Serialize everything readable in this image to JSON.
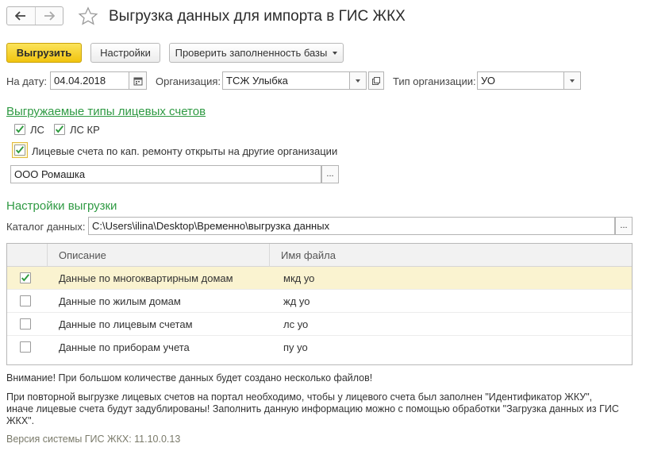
{
  "window": {
    "title": "Выгрузка данных для импорта в ГИС ЖКХ"
  },
  "toolbar": {
    "export_label": "Выгрузить",
    "settings_label": "Настройки",
    "check_label": "Проверить заполненность базы"
  },
  "filters": {
    "date_label": "На дату:",
    "date_value": "04.04.2018",
    "org_label": "Организация:",
    "org_value": "ТСЖ Улыбка",
    "org_type_label": "Тип организации:",
    "org_type_value": "УО"
  },
  "account_types": {
    "heading": "Выгружаемые типы лицевых счетов",
    "ls_label": "ЛС",
    "ls_checked": true,
    "ls_kr_label": "ЛС КР",
    "ls_kr_checked": true,
    "other_org_label": "Лицевые счета по кап. ремонту открыты на другие организации",
    "other_org_checked": true,
    "other_org_value": "ООО Ромашка"
  },
  "export_settings": {
    "heading": "Настройки выгрузки",
    "catalog_label": "Каталог данных:",
    "catalog_value": "C:\\Users\\ilina\\Desktop\\Временно\\выгрузка данных"
  },
  "table": {
    "col_description": "Описание",
    "col_filename": "Имя файла",
    "rows": [
      {
        "checked": true,
        "description": "Данные по многоквартирным домам",
        "filename": "мкд уо"
      },
      {
        "checked": false,
        "description": "Данные по жилым домам",
        "filename": "жд уо"
      },
      {
        "checked": false,
        "description": "Данные по лицевым счетам",
        "filename": "лс уо"
      },
      {
        "checked": false,
        "description": "Данные по приборам учета",
        "filename": "пу уо"
      }
    ]
  },
  "notes": {
    "warning": "Внимание! При большом количестве данных будет создано несколько файлов!",
    "info": "При повторной выгрузке лицевых счетов на портал необходимо, чтобы у лицевого счета был заполнен \"Идентификатор ЖКУ\", иначе лицевые счета будут задублированы! Заполнить данную информацию можно с помощью обработки \"Загрузка данных из ГИС ЖКХ\".",
    "version": "Версия системы ГИС ЖКХ: 11.10.0.13"
  },
  "colors": {
    "accent_green": "#2f9a43",
    "primary_yellow": "#f5d022",
    "check_green": "#2e9b3e",
    "selected_row": "#faf3d0"
  }
}
